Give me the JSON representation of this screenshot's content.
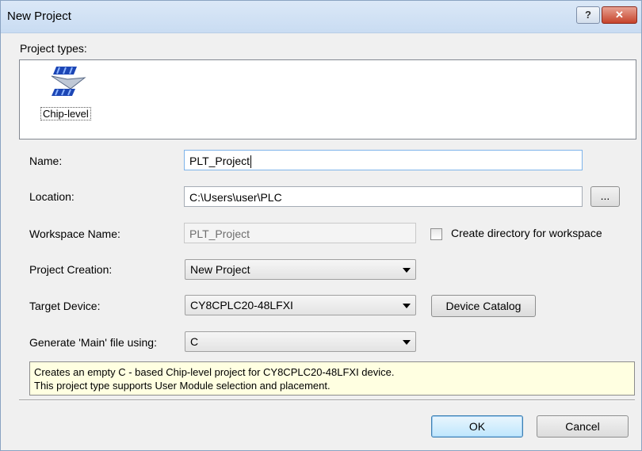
{
  "window": {
    "title": "New Project"
  },
  "titlebar": {
    "help_label": "?",
    "close_label": "✕"
  },
  "project_types": {
    "label": "Project types:",
    "items": [
      {
        "label": "Chip-level",
        "icon": "chip-level-icon"
      }
    ]
  },
  "form": {
    "name": {
      "label": "Name:",
      "value": "PLT_Project"
    },
    "location": {
      "label": "Location:",
      "value": "C:\\Users\\user\\PLC",
      "browse_label": "..."
    },
    "workspace": {
      "label": "Workspace Name:",
      "value": "PLT_Project",
      "checkbox_label": "Create directory for workspace",
      "checked": false
    },
    "project_creation": {
      "label": "Project Creation:",
      "value": "New Project"
    },
    "target_device": {
      "label": "Target Device:",
      "value": "CY8CPLC20-48LFXI",
      "catalog_label": "Device Catalog"
    },
    "main_file": {
      "label": "Generate 'Main' file using:",
      "value": "C"
    }
  },
  "info": {
    "line1": "Creates an empty C - based Chip-level project for CY8CPLC20-48LFXI device.",
    "line2": "This project type supports User Module selection and placement."
  },
  "buttons": {
    "ok": "OK",
    "cancel": "Cancel"
  },
  "colors": {
    "info_bg": "#ffffe1",
    "close_red": "#c6432b",
    "title_bar": "#dbe8f7"
  }
}
